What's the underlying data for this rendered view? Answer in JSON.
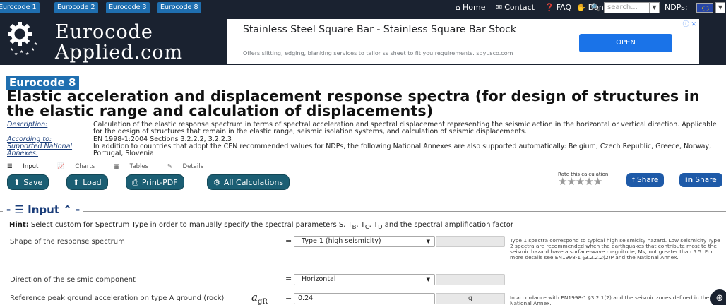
{
  "topbar": {
    "eurocodes": [
      "Eurocode 1",
      "Eurocode 2",
      "Eurocode 3",
      "Eurocode 8"
    ],
    "home": "Home",
    "contact": "Contact",
    "faq": "FAQ",
    "donate": "Donate",
    "search_placeholder": "search...",
    "ndps_label": "NDPs:"
  },
  "logo": {
    "line1": "Eurocode",
    "line2": "Applied.com"
  },
  "ad": {
    "title": "Stainless Steel Square Bar - Stainless Square Bar Stock",
    "desc": "Offers slitting, edging, blanking services to tailor ss sheet to fit you requirements. sdyusco.com",
    "button": "OPEN"
  },
  "page": {
    "badge": "Eurocode 8",
    "title": "Elastic acceleration and displacement response spectra (for design of structures in the elastic range and calculation of displacements)",
    "description_label": "Description:",
    "description": "Calculation of the elastic response spectrum in terms of spectral acceleration and spectral displacement representing the seismic action in the horizontal or vertical direction. Applicable for the design of structures that remain in the elastic range, seismic isolation systems, and calculation of seismic displacements.",
    "according_label": "According to:",
    "according": "EN 1998-1:2004 Sections 3.2.2.2, 3.2.2.3",
    "annexes_label": "Supported National Annexes:",
    "annexes": "In addition to countries that adopt the CEN recommended values for NDPs, the following National Annexes are also supported automatically: Belgium, Czech Republic, Greece, Norway, Portugal, Slovenia"
  },
  "subtabs": [
    "Input",
    "Charts",
    "Tables",
    "Details"
  ],
  "toolbar": {
    "save": "Save",
    "load": "Load",
    "print": "Print-PDF",
    "all": "All Calculations",
    "rate": "Rate this calculation:",
    "stars": "★★★★★",
    "share_fb": "Share",
    "share_in": "Share"
  },
  "input": {
    "section_title": "Input",
    "hint_label": "Hint:",
    "hint_text": " Select custom for Spectrum Type in order to manually specify the spectral parameters S, T",
    "hint_text2": ", T",
    "hint_text3": ", T",
    "hint_text4": " and the spectral amplification factor",
    "sub_b": "B",
    "sub_c": "C",
    "sub_d": "D",
    "rows": [
      {
        "label": "Shape of the response spectrum",
        "value": "Type 1 (high seismicity)",
        "note": "Type 1 spectra correspond to typical high seismicity hazard. Low seismicity Type 2 spectra are recommended when the earthquakes that contribute most to the seismic hazard have a surface-wave magnitude, Ms, not greater than 5.5. For more details see EN1998-1 §3.2.2.2(2)P and the National Annex."
      },
      {
        "label": "Direction of the seismic component",
        "value": "Horizontal"
      },
      {
        "label": "Reference peak ground acceleration on type A ground (rock)",
        "sym": "a",
        "sym_sub": "gR",
        "value": "0.24",
        "unit": "g",
        "note": "In accordance with EN1998-1 §3.2.1(2) and the seismic zones defined in the National Annex."
      }
    ]
  }
}
